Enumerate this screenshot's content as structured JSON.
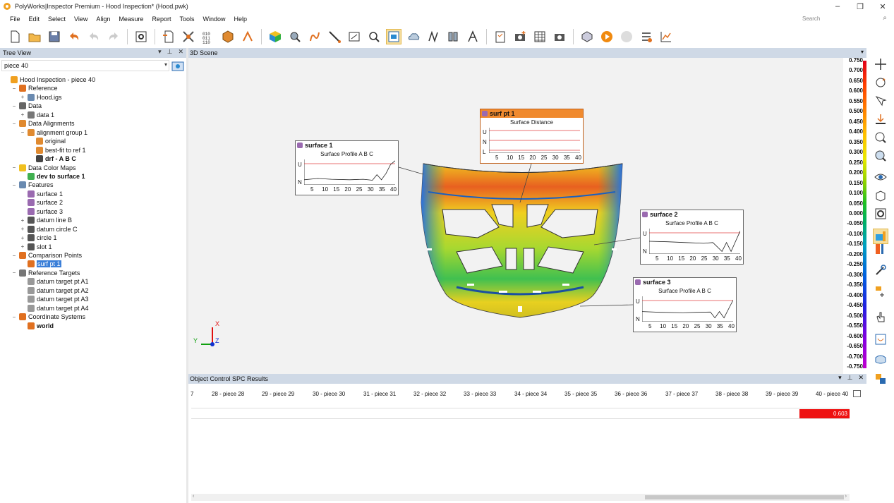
{
  "window": {
    "title": "PolyWorks|Inspector Premium - Hood Inspection* (Hood.pwk)",
    "controls": [
      "–",
      "❐",
      "✕"
    ]
  },
  "menu": [
    "File",
    "Edit",
    "Select",
    "View",
    "Align",
    "Measure",
    "Report",
    "Tools",
    "Window",
    "Help"
  ],
  "search": {
    "placeholder": "Search"
  },
  "tree_panel": {
    "title": "Tree View",
    "filter_value": "piece 40",
    "items": [
      {
        "label": "Hood Inspection - piece 40",
        "level": 0,
        "exp": "",
        "icon": "project-icon",
        "bold": false
      },
      {
        "label": "Reference",
        "level": 1,
        "exp": "−",
        "icon": "reference-icon",
        "bold": false
      },
      {
        "label": "Hood.igs",
        "level": 2,
        "exp": "+",
        "icon": "cad-file-icon",
        "bold": false
      },
      {
        "label": "Data",
        "level": 1,
        "exp": "−",
        "icon": "data-icon",
        "bold": false
      },
      {
        "label": "data 1",
        "level": 2,
        "exp": "+",
        "icon": "data-object-icon",
        "bold": false
      },
      {
        "label": "Data Alignments",
        "level": 1,
        "exp": "−",
        "icon": "alignment-icon",
        "bold": false
      },
      {
        "label": "alignment group 1",
        "level": 2,
        "exp": "−",
        "icon": "alignment-group-icon",
        "bold": false
      },
      {
        "label": "original",
        "level": 3,
        "exp": "",
        "icon": "alignment-original-icon",
        "bold": false
      },
      {
        "label": "best-fit to ref 1",
        "level": 3,
        "exp": "",
        "icon": "best-fit-icon",
        "bold": false
      },
      {
        "label": "drf - A B C",
        "level": 3,
        "exp": "",
        "icon": "drf-icon",
        "bold": true
      },
      {
        "label": "Data Color Maps",
        "level": 1,
        "exp": "−",
        "icon": "color-map-icon",
        "bold": false
      },
      {
        "label": "dev to surface 1",
        "level": 2,
        "exp": "",
        "icon": "deviation-map-icon",
        "bold": true
      },
      {
        "label": "Features",
        "level": 1,
        "exp": "−",
        "icon": "features-icon",
        "bold": false
      },
      {
        "label": "surface 1",
        "level": 2,
        "exp": "",
        "icon": "surface-feature-icon",
        "bold": false
      },
      {
        "label": "surface 2",
        "level": 2,
        "exp": "",
        "icon": "surface-feature-icon",
        "bold": false
      },
      {
        "label": "surface 3",
        "level": 2,
        "exp": "",
        "icon": "surface-feature-icon",
        "bold": false
      },
      {
        "label": "datum line B",
        "level": 2,
        "exp": "+",
        "icon": "datum-line-icon",
        "bold": false
      },
      {
        "label": "datum circle C",
        "level": 2,
        "exp": "+",
        "icon": "datum-circle-icon",
        "bold": false
      },
      {
        "label": "circle 1",
        "level": 2,
        "exp": "+",
        "icon": "circle-icon",
        "bold": false
      },
      {
        "label": "slot 1",
        "level": 2,
        "exp": "+",
        "icon": "slot-icon",
        "bold": false
      },
      {
        "label": "Comparison Points",
        "level": 1,
        "exp": "−",
        "icon": "comparison-points-icon",
        "bold": false
      },
      {
        "label": "surf pt 1",
        "level": 2,
        "exp": "",
        "icon": "surface-point-icon",
        "bold": false,
        "selected": true
      },
      {
        "label": "Reference Targets",
        "level": 1,
        "exp": "−",
        "icon": "reference-targets-icon",
        "bold": false
      },
      {
        "label": "datum target pt A1",
        "level": 2,
        "exp": "",
        "icon": "target-point-icon",
        "bold": false
      },
      {
        "label": "datum target pt A2",
        "level": 2,
        "exp": "",
        "icon": "target-point-icon",
        "bold": false
      },
      {
        "label": "datum target pt A3",
        "level": 2,
        "exp": "",
        "icon": "target-point-icon",
        "bold": false
      },
      {
        "label": "datum target pt A4",
        "level": 2,
        "exp": "",
        "icon": "target-point-icon",
        "bold": false
      },
      {
        "label": "Coordinate Systems",
        "level": 1,
        "exp": "−",
        "icon": "coordinate-systems-icon",
        "bold": false
      },
      {
        "label": "world",
        "level": 2,
        "exp": "",
        "icon": "world-axes-icon",
        "bold": true
      }
    ]
  },
  "scene": {
    "title": "3D Scene",
    "triad": {
      "x": "X",
      "y": "Y",
      "z": "Z"
    },
    "color_scale": [
      "0.750",
      "0.700",
      "0.650",
      "0.600",
      "0.550",
      "0.500",
      "0.450",
      "0.400",
      "0.350",
      "0.300",
      "0.250",
      "0.200",
      "0.150",
      "0.100",
      "0.050",
      "0.000",
      "-0.050",
      "-0.100",
      "-0.150",
      "-0.200",
      "-0.250",
      "-0.300",
      "-0.350",
      "-0.400",
      "-0.450",
      "-0.500",
      "-0.550",
      "-0.600",
      "-0.650",
      "-0.700",
      "-0.750"
    ],
    "callouts": [
      {
        "id": "surface-1",
        "name": "surface 1",
        "chart_title": "Surface Profile A B C",
        "y_ticks": [
          "U",
          "N"
        ],
        "x_ticks": [
          "5",
          "10",
          "15",
          "20",
          "25",
          "30",
          "35",
          "40"
        ],
        "highlight": false
      },
      {
        "id": "surf-pt-1",
        "name": "surf pt 1",
        "chart_title": "Surface Distance",
        "y_ticks": [
          "U",
          "N",
          "L"
        ],
        "x_ticks": [
          "5",
          "10",
          "15",
          "20",
          "25",
          "30",
          "35",
          "40"
        ],
        "highlight": true
      },
      {
        "id": "surface-2",
        "name": "surface 2",
        "chart_title": "Surface Profile A B C",
        "y_ticks": [
          "U",
          "N"
        ],
        "x_ticks": [
          "5",
          "10",
          "15",
          "20",
          "25",
          "30",
          "35",
          "40"
        ],
        "highlight": false
      },
      {
        "id": "surface-3",
        "name": "surface 3",
        "chart_title": "Surface Profile A B C",
        "y_ticks": [
          "U",
          "N"
        ],
        "x_ticks": [
          "5",
          "10",
          "15",
          "20",
          "25",
          "30",
          "35",
          "40"
        ],
        "highlight": false
      }
    ]
  },
  "spc": {
    "title": "Object Control SPC Results",
    "columns": [
      "7",
      "28 - piece 28",
      "29 - piece 29",
      "30 - piece 30",
      "31 - piece 31",
      "32 - piece 32",
      "33 - piece 33",
      "34 - piece 34",
      "35 - piece 35",
      "36 - piece 36",
      "37 - piece 37",
      "38 - piece 38",
      "39 - piece 39",
      "40 - piece 40"
    ],
    "value": "0.603",
    "value_color": "#ee1111"
  },
  "colors": {
    "panel_header": "#cfd9e6",
    "highlight_callout": "#f08a2e",
    "active_tool": "#f6dfa0",
    "selection": "#3b7fd8"
  }
}
